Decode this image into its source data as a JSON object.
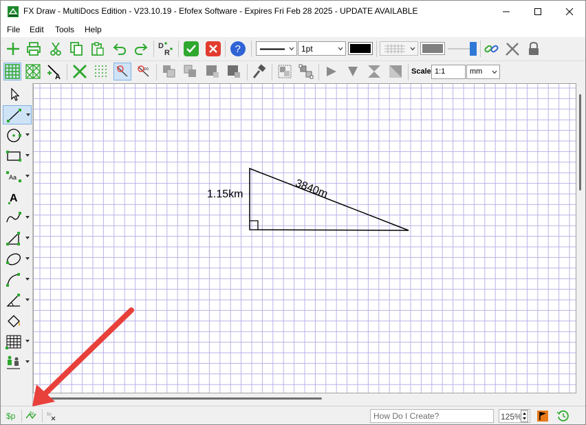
{
  "window": {
    "title": "FX Draw - MultiDocs Edition - V23.10.19 - Efofex Software - Expires Fri Feb 28 2025 - UPDATE AVAILABLE"
  },
  "menu": {
    "items": [
      "File",
      "Edit",
      "Tools",
      "Help"
    ]
  },
  "toolbar1": {
    "line_style": "solid",
    "line_width": "1pt",
    "line_color": "#000000",
    "fill_color": "#808080"
  },
  "toolbar2": {
    "scale_label": "Scale",
    "scale_value": "1:1",
    "units_value": "mm"
  },
  "drawing": {
    "side_vertical_label": "1.15km",
    "hypotenuse_label": "3840m"
  },
  "statusbar": {
    "dollar_p": "$p",
    "how_do_i_placeholder": "How Do I Create?",
    "zoom_value": "125%"
  },
  "colors": {
    "accent_green": "#2fa82f",
    "grid_line": "#b9b3e8",
    "annotation_arrow": "#e8403a",
    "help_blue": "#2f63d6"
  }
}
